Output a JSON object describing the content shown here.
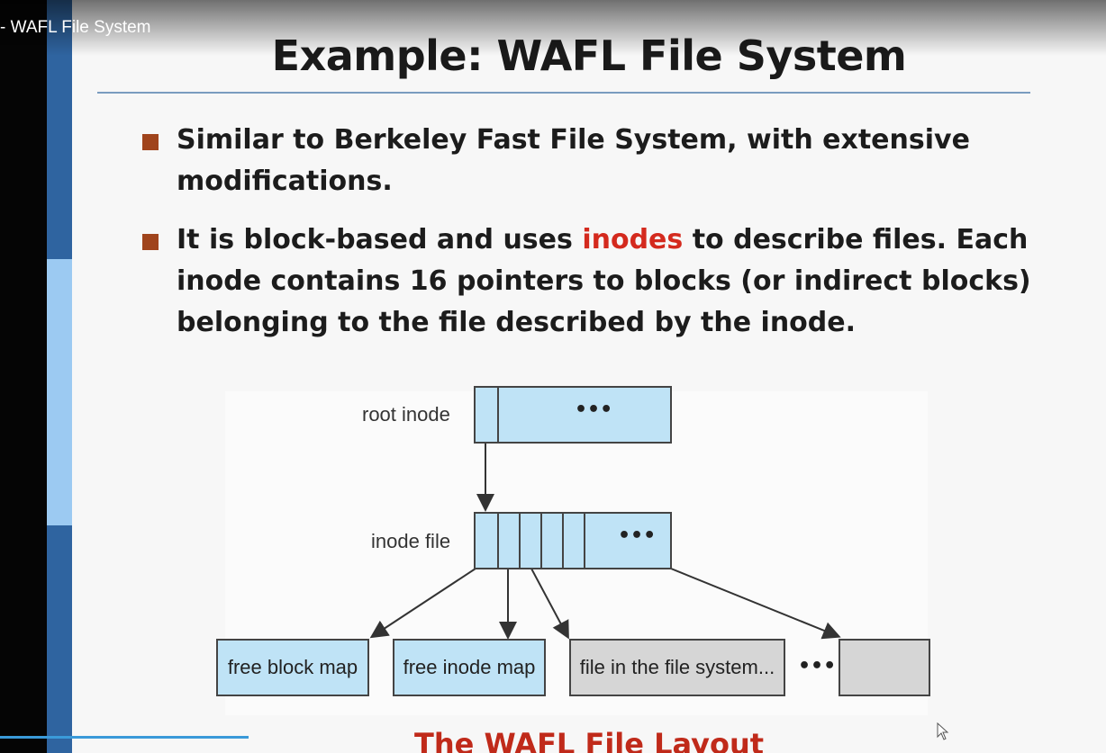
{
  "video": {
    "title": "- WAFL File System"
  },
  "slide": {
    "title": "Example: WAFL File System",
    "bullets": [
      {
        "text": "Similar to Berkeley Fast File System, with extensive modifications."
      },
      {
        "before": "It is block-based and uses ",
        "highlight": "inodes",
        "after": " to describe files. Each inode contains 16 pointers to blocks (or indirect blocks) belonging to the file described by the inode."
      }
    ],
    "caption": "The WAFL File Layout"
  },
  "diagram": {
    "root_label": "root inode",
    "inode_label": "inode file",
    "ellipsis": "•••",
    "leaves": [
      "free block map",
      "free inode map",
      "file in the file system...",
      ""
    ]
  },
  "colors": {
    "accent_red": "#d42a1e",
    "bullet_square": "#a0441c",
    "box_blue": "#bfe3f6",
    "box_gray": "#d6d6d6"
  }
}
